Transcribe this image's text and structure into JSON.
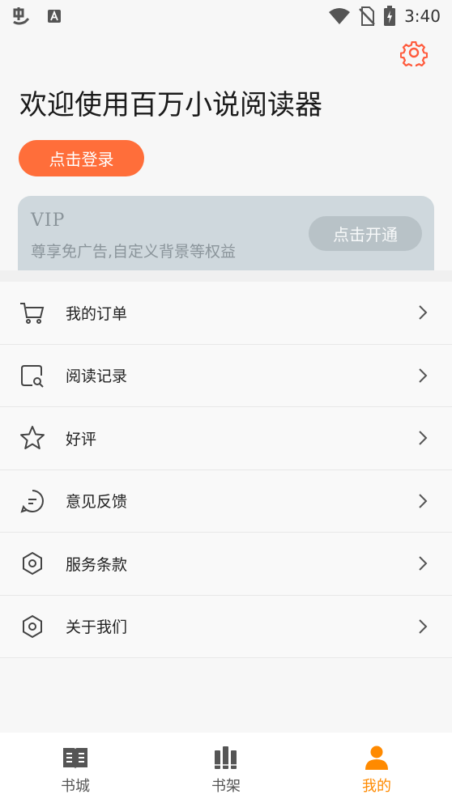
{
  "status_bar": {
    "time": "3:40",
    "icons": [
      "app-logo-icon",
      "text-a-icon",
      "wifi-icon",
      "no-sim-icon",
      "battery-charging-icon"
    ]
  },
  "header": {
    "settings_icon": "gear-icon",
    "welcome_title": "欢迎使用百万小说阅读器",
    "login_label": "点击登录"
  },
  "vip": {
    "title": "VIP",
    "subtitle": "尊享免广告,自定义背景等权益",
    "open_label": "点击开通"
  },
  "menu": {
    "items": [
      {
        "label": "我的订单",
        "icon": "cart-icon"
      },
      {
        "label": "阅读记录",
        "icon": "reading-history-icon"
      },
      {
        "label": "好评",
        "icon": "star-icon"
      },
      {
        "label": "意见反馈",
        "icon": "feedback-chat-icon"
      },
      {
        "label": "服务条款",
        "icon": "hexagon-icon"
      },
      {
        "label": "关于我们",
        "icon": "hexagon-icon"
      }
    ]
  },
  "bottom_nav": {
    "items": [
      {
        "label": "书城",
        "icon": "book-store-icon"
      },
      {
        "label": "书架",
        "icon": "bookshelf-icon"
      },
      {
        "label": "我的",
        "icon": "user-icon",
        "active": true
      }
    ]
  },
  "colors": {
    "accent": "#ff6e3a",
    "active_nav": "#ff8a00",
    "vip_card": "#cfd8dd"
  }
}
